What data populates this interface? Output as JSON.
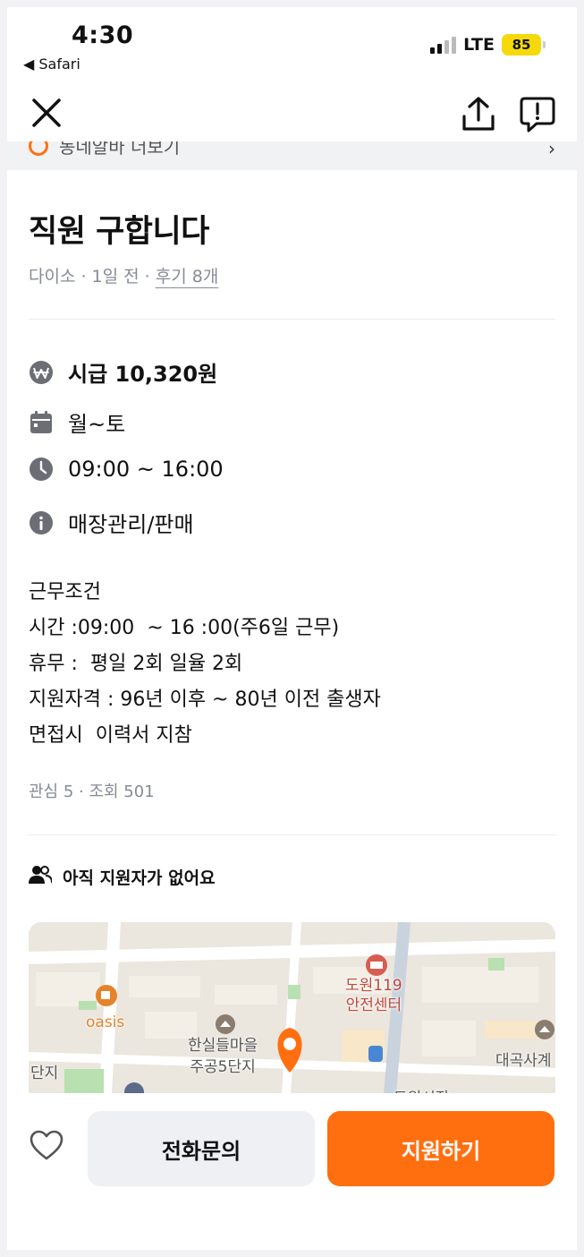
{
  "status_bar": {
    "time": "4:30",
    "back_app": "◀ Safari",
    "network": "LTE",
    "battery": "85"
  },
  "banner": {
    "text": "동네알바 더보기"
  },
  "post": {
    "title": "직원 구합니다",
    "meta_prefix": "다이소 · 1일 전 · ",
    "reviews_link": "후기 8개"
  },
  "info": {
    "wage": "시급 10,320원",
    "days": "월~토",
    "hours": "09:00 ~ 16:00",
    "category": "매장관리/판매"
  },
  "description": [
    "근무조건",
    "시간 :09:00  ~ 16 :00(주6일 근무)",
    "휴무 :  평일 2회 일율 2회",
    "지원자격 : 96년 이후 ~ 80년 이전 출생자",
    "면접시  이력서 지참"
  ],
  "stats": "관심 5 · 조회 501",
  "applicants": "아직 지원자가 없어요",
  "map": {
    "labels": {
      "station": "도원119\n안전센터",
      "apartment": "한실들마을\n주공5단지",
      "cafe": "oasis",
      "left_edge": "단지",
      "right_edge": "대곡사계",
      "bottom": "도원시장"
    }
  },
  "actions": {
    "call": "전화문의",
    "apply": "지원하기"
  },
  "colors": {
    "accent": "#ff6f0f",
    "muted_text": "#868b94"
  }
}
